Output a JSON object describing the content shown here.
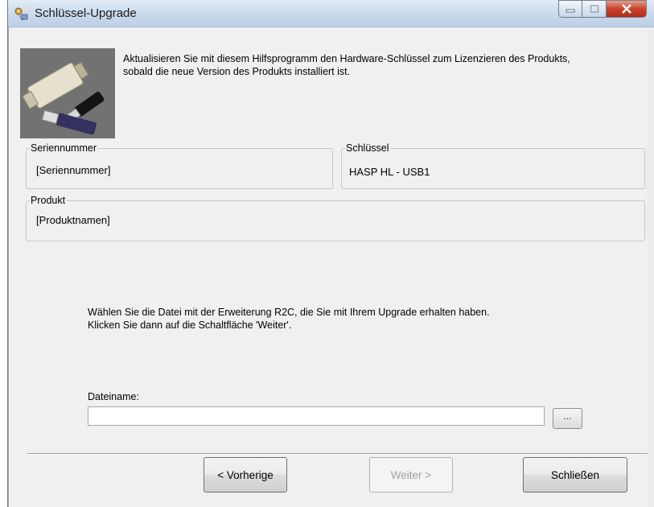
{
  "window": {
    "title": "Schlüssel-Upgrade",
    "icon": "key-program-icon"
  },
  "intro": {
    "line1": "Aktualisieren Sie mit diesem Hilfsprogramm den Hardware-Schlüssel zum Lizenzieren des Produkts,",
    "line2": "sobald die neue Version des Produkts installiert ist."
  },
  "serial_group": {
    "label": "Seriennummer",
    "value": "[Seriennummer]"
  },
  "key_group": {
    "label": "Schlüssel",
    "value": "HASP HL - USB1"
  },
  "product_group": {
    "label": "Produkt",
    "value": "[Produktnamen]"
  },
  "instructions": {
    "line1": "Wählen Sie die Datei mit der Erweiterung R2C, die Sie mit Ihrem Upgrade erhalten haben.",
    "line2": "Klicken Sie dann auf die Schaltfläche 'Weiter'."
  },
  "file": {
    "label": "Dateiname:",
    "value": "",
    "browse_label": "..."
  },
  "buttons": {
    "back": "< Vorherige",
    "next": "Weiter >",
    "close": "Schließen"
  }
}
